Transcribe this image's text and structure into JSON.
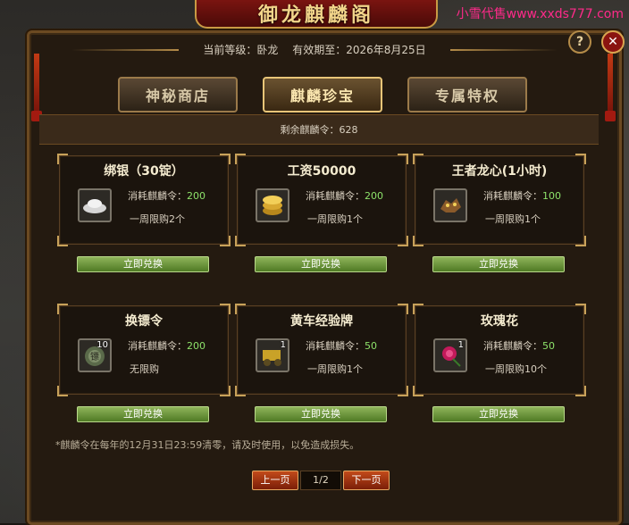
{
  "title": "御龙麒麟阁",
  "watermark": "小雪代售www.xxds777.com",
  "info": {
    "level_label": "当前等级：卧龙",
    "expiry_label": "有效期至：2026年8月25日"
  },
  "tabs": [
    {
      "label": "神秘商店",
      "active": false
    },
    {
      "label": "麒麟珍宝",
      "active": true
    },
    {
      "label": "专属特权",
      "active": false
    }
  ],
  "remaining": "剩余麒麟令：628",
  "items": [
    {
      "name": "绑银（30锭）",
      "cost_label": "消耗麒麟令：",
      "cost": "200",
      "limit": "一周限购2个",
      "qty": "",
      "icon": "silver-ingot-icon",
      "button": "立即兑换"
    },
    {
      "name": "工资50000",
      "cost_label": "消耗麒麟令：",
      "cost": "200",
      "limit": "一周限购1个",
      "qty": "",
      "icon": "gold-coins-icon",
      "button": "立即兑换"
    },
    {
      "name": "王者龙心(1小时)",
      "cost_label": "消耗麒麟令：",
      "cost": "100",
      "limit": "一周限购1个",
      "qty": "",
      "icon": "dragon-heart-icon",
      "button": "立即兑换"
    },
    {
      "name": "换镖令",
      "cost_label": "消耗麒麟令：",
      "cost": "200",
      "limit": "无限购",
      "qty": "10",
      "icon": "escort-token-icon",
      "button": "立即兑换"
    },
    {
      "name": "黄车经验牌",
      "cost_label": "消耗麒麟令：",
      "cost": "50",
      "limit": "一周限购1个",
      "qty": "1",
      "icon": "yellow-cart-exp-icon",
      "button": "立即兑换"
    },
    {
      "name": "玫瑰花",
      "cost_label": "消耗麒麟令：",
      "cost": "50",
      "limit": "一周限购10个",
      "qty": "1",
      "icon": "rose-icon",
      "button": "立即兑换"
    }
  ],
  "footnote": "*麒麟令在每年的12月31日23:59清零，请及时使用，以免造成损失。",
  "pager": {
    "prev": "上一页",
    "page": "1/2",
    "next": "下一页"
  },
  "help_glyph": "?",
  "close_glyph": "✕",
  "colors": {
    "accent_gold": "#c8a25a",
    "cost_green": "#8de26a",
    "button_green": "#6a9a3a",
    "pager_red": "#a8340f"
  }
}
